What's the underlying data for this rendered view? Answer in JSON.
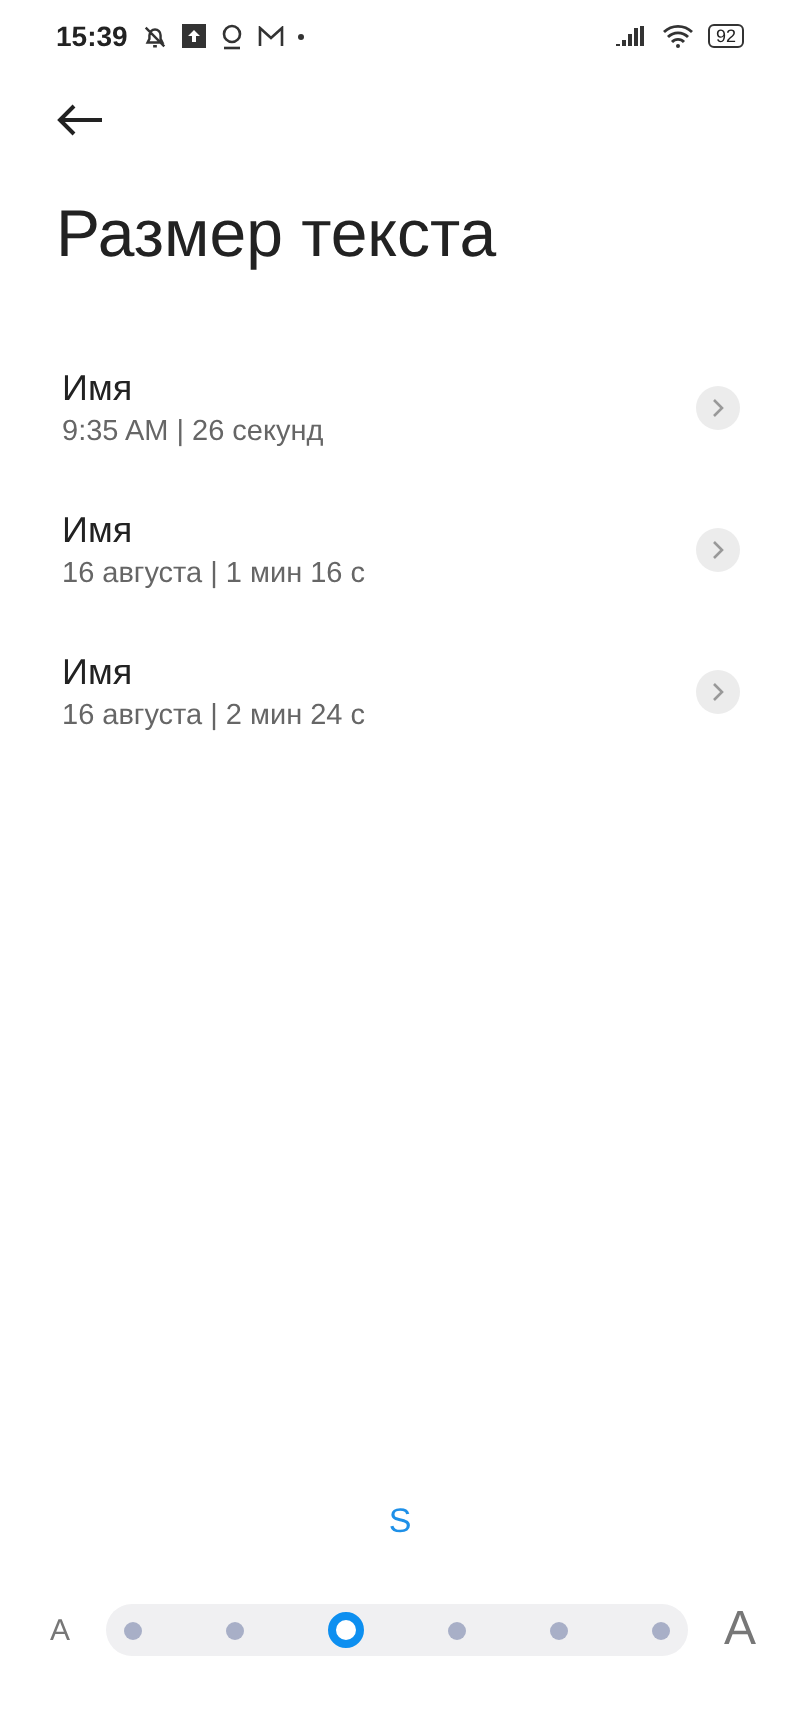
{
  "status_bar": {
    "time": "15:39",
    "battery": "92"
  },
  "title": "Размер текста",
  "items": [
    {
      "name": "Имя",
      "detail": "9:35 AM | 26 секунд"
    },
    {
      "name": "Имя",
      "detail": "16 августа | 1 мин 16 с"
    },
    {
      "name": "Имя",
      "detail": "16 августа | 2 мин 24 с"
    }
  ],
  "size_label": "S",
  "slider": {
    "small_label": "A",
    "large_label": "A",
    "stops": [
      {
        "selected": false
      },
      {
        "selected": false
      },
      {
        "selected": true
      },
      {
        "selected": false
      },
      {
        "selected": false
      },
      {
        "selected": false
      }
    ]
  }
}
